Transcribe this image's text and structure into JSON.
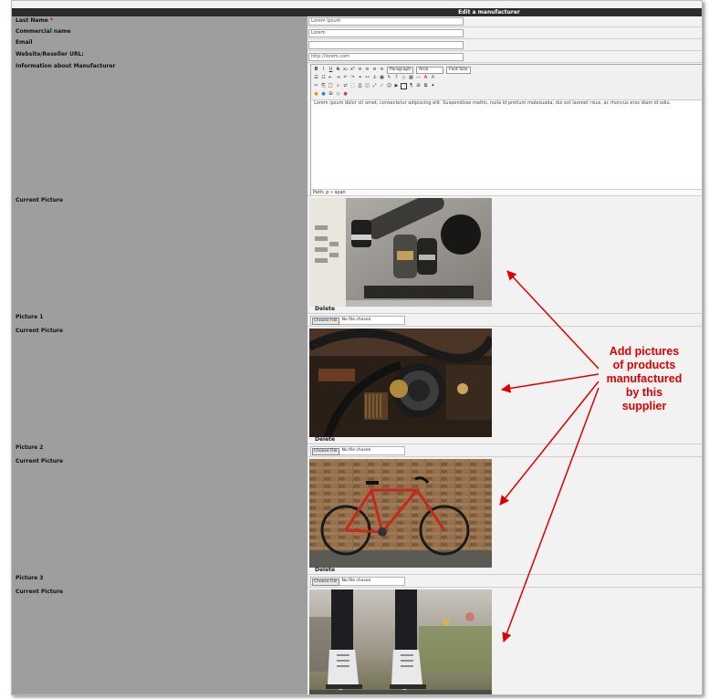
{
  "window": {
    "title": "Edit a manufacturer"
  },
  "fields": {
    "last_name": {
      "label": "Last Name",
      "required_mark": "*",
      "value": "Lorem Ipsum"
    },
    "commercial_name": {
      "label": "Commercial name",
      "value": "Lorem"
    },
    "email": {
      "label": "Email",
      "value": ""
    },
    "website": {
      "label": "Website/Reseller URL:",
      "value": "http://lorem.com"
    },
    "information": {
      "label": "Information about Manufacturer"
    }
  },
  "editor": {
    "block_format": "Paragraph",
    "font_family": "Arial",
    "font_size": "Font Size",
    "body_text": "Lorem ipsum dolor sit amet, consectetur adipiscing elit. Suspendisse mattis, nulla id pretium malesuada, dui est laoreet risus, ac rhoncus eros diam id odio.",
    "path": "Path: p » span"
  },
  "pictures": {
    "current_label": "Current Picture",
    "delete_label": "Delete",
    "choose_file_label": "Choose File",
    "no_file_label": "No file chosen",
    "slots": [
      {
        "label": "Picture 1",
        "subject": "microscope"
      },
      {
        "label": "Picture 2",
        "subject": "microphone"
      },
      {
        "label": "Picture 3",
        "subject": "bicycle"
      },
      {
        "subject": "boots"
      }
    ]
  },
  "annotation": {
    "lines": [
      "Add pictures",
      "of products",
      "manufactured",
      "by this",
      "supplier"
    ],
    "color": "#e00000"
  }
}
